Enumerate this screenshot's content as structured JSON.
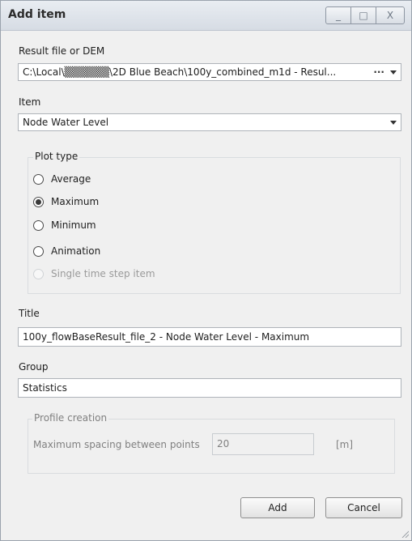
{
  "window": {
    "title": "Add item",
    "controls": {
      "minimize": "_",
      "maximize": "□",
      "close": "X"
    }
  },
  "result_file": {
    "label": "Result file or DEM",
    "value": "C:\\Local\\▒▒▒▒▒▒\\2D Blue Beach\\100y_combined_m1d - Resul...",
    "browse": "···"
  },
  "item": {
    "label": "Item",
    "value": "Node Water Level"
  },
  "plot_type": {
    "label": "Plot type",
    "options": [
      {
        "label": "Average",
        "checked": false,
        "enabled": true
      },
      {
        "label": "Maximum",
        "checked": true,
        "enabled": true
      },
      {
        "label": "Minimum",
        "checked": false,
        "enabled": true
      },
      {
        "label": "Animation",
        "checked": false,
        "enabled": true
      },
      {
        "label": "Single time step item",
        "checked": false,
        "enabled": false
      }
    ]
  },
  "title_field": {
    "label": "Title",
    "value": "100y_flowBaseResult_file_2 - Node Water Level - Maximum"
  },
  "group_field": {
    "label": "Group",
    "value": "Statistics"
  },
  "profile_creation": {
    "label": "Profile creation",
    "spacing_label": "Maximum spacing between points",
    "spacing_value": "20",
    "unit": "[m]"
  },
  "buttons": {
    "add": "Add",
    "cancel": "Cancel"
  }
}
